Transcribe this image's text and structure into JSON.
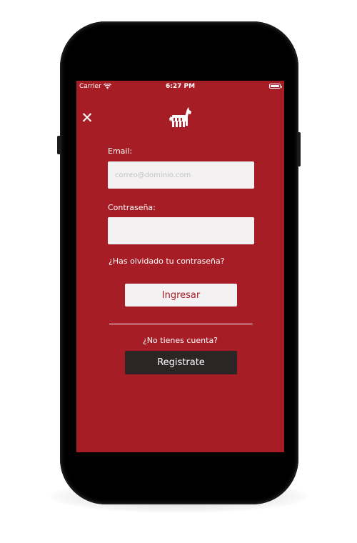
{
  "status_bar": {
    "carrier": "Carrier",
    "time": "6:27 PM"
  },
  "header": {
    "close_icon": "close-x-icon",
    "logo_icon": "horse-logo-icon"
  },
  "form": {
    "email_label": "Email:",
    "email_placeholder": "correo@dominio.com",
    "email_value": "",
    "password_label": "Contraseña:",
    "password_value": "",
    "forgot_link": "¿Has olvidado tu contraseña?",
    "login_button": "Ingresar"
  },
  "signup": {
    "prompt": "¿No tienes cuenta?",
    "register_button": "Registrate"
  },
  "colors": {
    "background": "#a71d26",
    "input_background": "#f3f1f1",
    "register_button": "#2c2526",
    "text": "#ffffff"
  }
}
